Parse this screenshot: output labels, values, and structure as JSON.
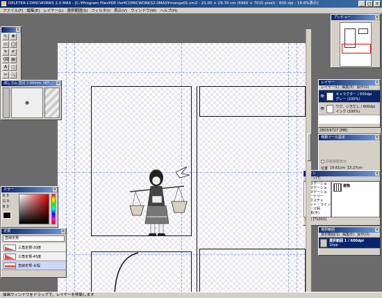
{
  "window": {
    "title": "DELETER-COMICWORKS 2.0 MAX - [C:¥Program Files¥DE lhe¥COMICWORKS2.0MAX¥manga01.cm2 - 21.00 × 29.70 cm (4960 × 7015 pixel) - 600 dpi - 16.6%表示]",
    "min": "_",
    "max": "□",
    "close": "×"
  },
  "menu": [
    "ファイル(F)",
    "編集(E)",
    "レイヤー(L)",
    "選択範囲(S)",
    "フィルタ(I)",
    "表示(V)",
    "ウィンドウ(W)",
    "ヘルプ(H)"
  ],
  "toolbox": {
    "tools": [
      "↖",
      "✥",
      "▭",
      "◯",
      "✎",
      "✐",
      "⌫",
      "▤",
      "A",
      "⬚",
      "✂",
      "🔍",
      "✋",
      "⊕",
      "▯",
      "◩"
    ]
  },
  "brush_panel": {
    "title": "消しゴム  直径 2.00mm（47...",
    "close": "×"
  },
  "color_panel": {
    "title": "カラー",
    "r_label": "R",
    "g_label": "G",
    "b_label": "B",
    "r": "0",
    "g": "0",
    "b": "0"
  },
  "ruler_panel": {
    "title": "定規",
    "selected": "直線定規",
    "items": [
      {
        "label": "三角定規-30度"
      },
      {
        "label": "三角定規-45度"
      },
      {
        "label": "直線定規-太幅"
      }
    ]
  },
  "preview_panel": {
    "title": "プレビュー"
  },
  "layer_panel": {
    "title": "レイヤー",
    "menu": [
      "レイヤー(L)",
      "編集(E)",
      "操作(O)"
    ],
    "layers": [
      {
        "name": "キャラクター / 600dpi",
        "sub": "グレー (100%)",
        "selected": true
      },
      {
        "name": "ワク、シきだし / 600dpi",
        "sub": "インク (100%)",
        "selected": false
      }
    ],
    "status": "2803/9727 [MB]"
  },
  "move_panel": {
    "title": "移動ツール設定",
    "checkbox": "原稿移動表示",
    "pos_label": "位置",
    "x_value": "16.61cm",
    "y_value": "15.27cm"
  },
  "tone_panel": {
    "title": "トーン",
    "menu": [
      "トーン(T)"
    ],
    "items": [
      "グラデーショ",
      "グラデーショ",
      "グラデーショ",
      "シーナリー",
      "テクスチャ",
      "ドット・ライン",
      "レース柄",
      "効果(中)"
    ],
    "selected_name": "建物",
    "status": "建物 [TL002]"
  },
  "selection_panel": {
    "title": "選択範囲",
    "menu": [
      "選択範囲(S)",
      "編集(E)",
      "操作(O)"
    ],
    "item": "選択範囲 1 / 600dpi",
    "sub": "1bpp"
  },
  "status_bar": {
    "text": "描画ウィンドウをドラッグで、レイヤーを移動します"
  }
}
